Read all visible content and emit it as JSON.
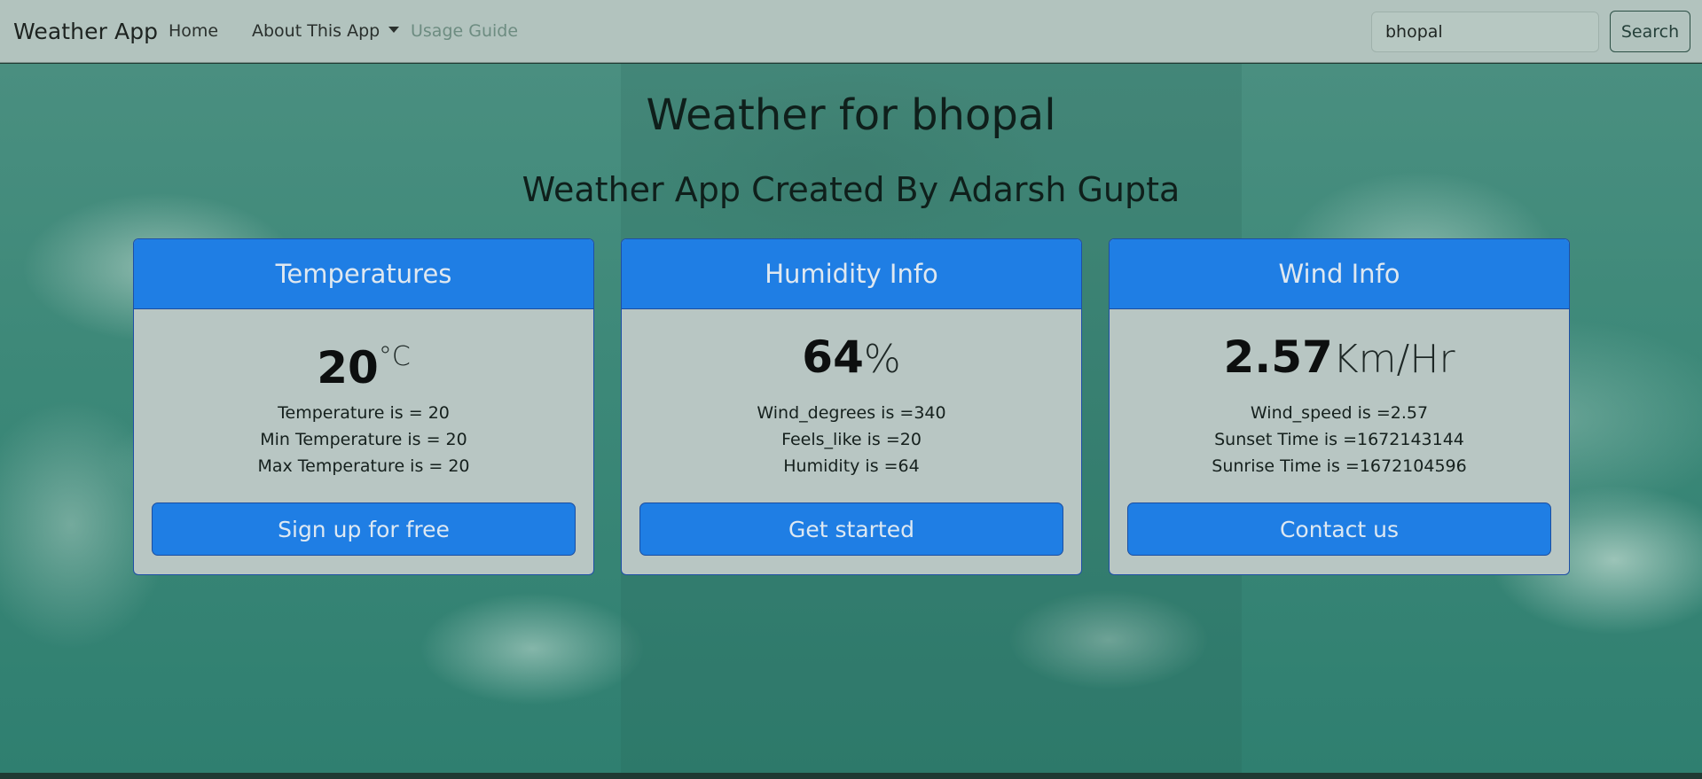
{
  "navbar": {
    "brand": "Weather App",
    "links": [
      {
        "label": "Home"
      },
      {
        "label": "About This App"
      },
      {
        "label": "Usage Guide"
      }
    ],
    "search": {
      "value": "bhopal",
      "button_label": "Search"
    }
  },
  "main": {
    "title": "Weather for bhopal",
    "subtitle": "Weather App Created By Adarsh Gupta",
    "cards": [
      {
        "header": "Temperatures",
        "value": "20",
        "unit": "°C",
        "lines": [
          "Temperature is = 20",
          "Min Temperature is = 20",
          "Max Temperature is = 20"
        ],
        "button": "Sign up for free"
      },
      {
        "header": "Humidity Info",
        "value": "64",
        "unit": "%",
        "lines": [
          "Wind_degrees is =340",
          "Feels_like is =20",
          "Humidity is =64"
        ],
        "button": "Get started"
      },
      {
        "header": "Wind Info",
        "value": "2.57",
        "unit": "Km/Hr",
        "lines": [
          "Wind_speed is =2.57",
          "Sunset Time is =1672143144",
          "Sunrise Time is =1672104596"
        ],
        "button": "Contact us"
      }
    ]
  },
  "colors": {
    "navbar_bg": "#b2c3be",
    "card_header": "#1f7ee4",
    "card_button": "#1f7ee4",
    "card_body": "#b8c6c3",
    "sky": "#3c8878"
  },
  "icons": {
    "dropdown": "chevron-down-icon"
  }
}
